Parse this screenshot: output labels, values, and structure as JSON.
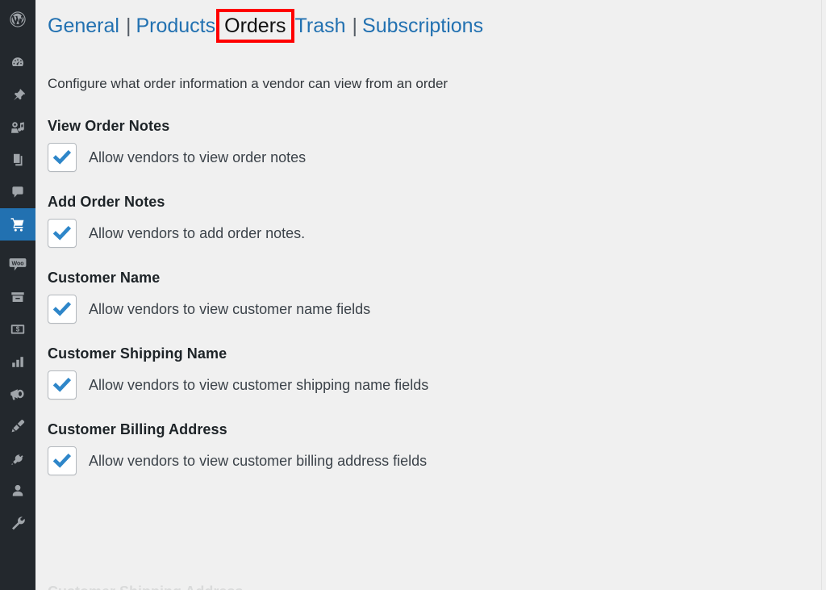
{
  "sidebar": {
    "background_color": "#23282d",
    "active_color": "#2271b1",
    "items": [
      {
        "name": "wordpress-logo",
        "label": "WordPress",
        "active": false
      },
      {
        "name": "dashboard",
        "label": "Dashboard",
        "active": false
      },
      {
        "name": "posts",
        "label": "Posts",
        "active": false
      },
      {
        "name": "media",
        "label": "Media",
        "active": false
      },
      {
        "name": "pages",
        "label": "Pages",
        "active": false
      },
      {
        "name": "comments",
        "label": "Comments",
        "active": false
      },
      {
        "name": "woocommerce-cart",
        "label": "WooCommerce",
        "active": true
      },
      {
        "name": "woo-products",
        "label": "Woo",
        "active": false
      },
      {
        "name": "archive",
        "label": "Archive",
        "active": false
      },
      {
        "name": "payments",
        "label": "Payments",
        "active": false
      },
      {
        "name": "analytics",
        "label": "Analytics",
        "active": false
      },
      {
        "name": "marketing",
        "label": "Marketing",
        "active": false
      },
      {
        "name": "appearance",
        "label": "Appearance",
        "active": false
      },
      {
        "name": "plugins",
        "label": "Plugins",
        "active": false
      },
      {
        "name": "users",
        "label": "Users",
        "active": false
      },
      {
        "name": "tools",
        "label": "Tools",
        "active": false
      }
    ]
  },
  "tabs": {
    "link_color": "#2271b1",
    "current_color": "#111111",
    "highlight_color": "#ff0000",
    "items": [
      {
        "label": "General",
        "current": false,
        "separator_after": true
      },
      {
        "label": "Products",
        "current": false,
        "separator_after": false
      },
      {
        "label": "Orders",
        "current": true,
        "separator_after": false
      },
      {
        "label": "Trash",
        "current": false,
        "separator_after": true
      },
      {
        "label": "Subscriptions",
        "current": false,
        "separator_after": false
      }
    ],
    "separator": "|"
  },
  "page": {
    "description": "Configure what order information a vendor can view from an order"
  },
  "settings": [
    {
      "heading": "View Order Notes",
      "checkbox_label": "Allow vendors to view order notes",
      "checked": true
    },
    {
      "heading": "Add Order Notes",
      "checkbox_label": "Allow vendors to add order notes.",
      "checked": true
    },
    {
      "heading": "Customer Name",
      "checkbox_label": "Allow vendors to view customer name fields",
      "checked": true
    },
    {
      "heading": "Customer Shipping Name",
      "checkbox_label": "Allow vendors to view customer shipping name fields",
      "checked": true
    },
    {
      "heading": "Customer Billing Address",
      "checkbox_label": "Allow vendors to view customer billing address fields",
      "checked": true
    }
  ],
  "bottom_partial": {
    "heading": "Customer Shipping Address"
  }
}
